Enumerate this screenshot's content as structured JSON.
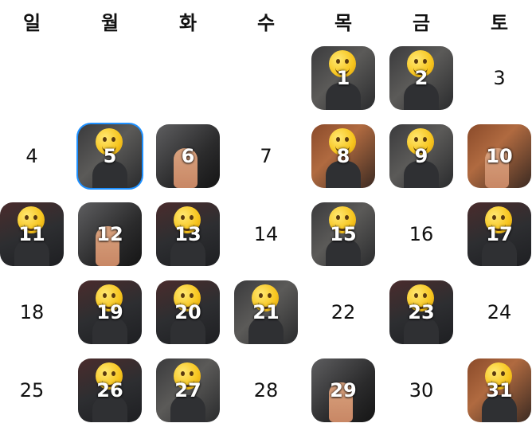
{
  "calendar": {
    "weekdays": [
      "일",
      "월",
      "화",
      "수",
      "목",
      "금",
      "토"
    ],
    "selected_day": "5",
    "days": [
      {
        "day": "1",
        "photo": true,
        "scene": "gym",
        "subject": "selfie"
      },
      {
        "day": "2",
        "photo": true,
        "scene": "gym",
        "subject": "selfie"
      },
      {
        "day": "3",
        "photo": false
      },
      {
        "day": "4",
        "photo": false
      },
      {
        "day": "5",
        "photo": true,
        "scene": "gym",
        "subject": "selfie"
      },
      {
        "day": "6",
        "photo": true,
        "scene": "dark",
        "subject": "thumbs-up"
      },
      {
        "day": "7",
        "photo": false
      },
      {
        "day": "8",
        "photo": true,
        "scene": "wood",
        "subject": "selfie"
      },
      {
        "day": "9",
        "photo": true,
        "scene": "gym",
        "subject": "selfie"
      },
      {
        "day": "10",
        "photo": true,
        "scene": "wood",
        "subject": "thumbs-up"
      },
      {
        "day": "11",
        "photo": true,
        "scene": "gym2",
        "subject": "selfie"
      },
      {
        "day": "12",
        "photo": true,
        "scene": "dark",
        "subject": "thumbs-up"
      },
      {
        "day": "13",
        "photo": true,
        "scene": "gym2",
        "subject": "selfie"
      },
      {
        "day": "14",
        "photo": false
      },
      {
        "day": "15",
        "photo": true,
        "scene": "gym",
        "subject": "selfie"
      },
      {
        "day": "16",
        "photo": false
      },
      {
        "day": "17",
        "photo": true,
        "scene": "gym2",
        "subject": "selfie"
      },
      {
        "day": "18",
        "photo": false
      },
      {
        "day": "19",
        "photo": true,
        "scene": "gym2",
        "subject": "selfie"
      },
      {
        "day": "20",
        "photo": true,
        "scene": "gym2",
        "subject": "selfie"
      },
      {
        "day": "21",
        "photo": true,
        "scene": "gym",
        "subject": "selfie"
      },
      {
        "day": "22",
        "photo": false
      },
      {
        "day": "23",
        "photo": true,
        "scene": "gym2",
        "subject": "selfie"
      },
      {
        "day": "24",
        "photo": false
      },
      {
        "day": "25",
        "photo": false
      },
      {
        "day": "26",
        "photo": true,
        "scene": "gym2",
        "subject": "selfie"
      },
      {
        "day": "27",
        "photo": true,
        "scene": "gym",
        "subject": "selfie"
      },
      {
        "day": "28",
        "photo": false
      },
      {
        "day": "29",
        "photo": true,
        "scene": "dark",
        "subject": "thumbs-up"
      },
      {
        "day": "30",
        "photo": false
      },
      {
        "day": "31",
        "photo": true,
        "scene": "wood",
        "subject": "selfie"
      }
    ],
    "colors": {
      "selected_outline": "#1e90ff",
      "emoji_face": "#f7c51e",
      "text": "#111111"
    }
  }
}
